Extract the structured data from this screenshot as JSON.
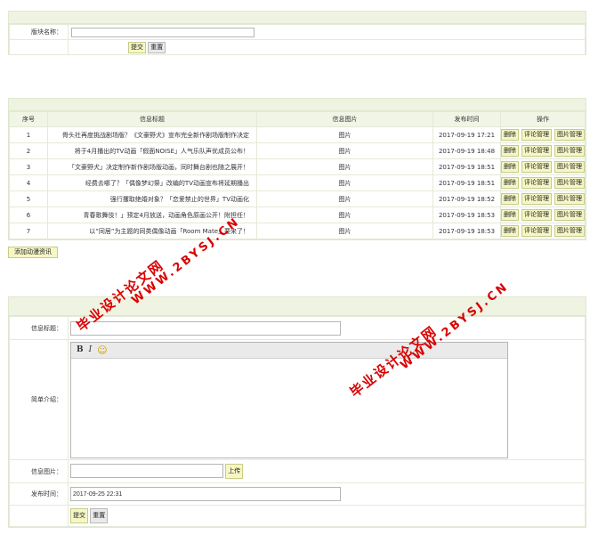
{
  "board_form": {
    "label": "版块名称：",
    "value": "",
    "submit": "提交",
    "reset": "重置"
  },
  "news_table": {
    "headers": [
      "序号",
      "信息标题",
      "信息图片",
      "发布时间",
      "操作"
    ],
    "rows": [
      {
        "no": "1",
        "title": "骨头社再度挑战剧场版？《文豪野犬》宣布完全新作剧场版制作决定",
        "image": "图片",
        "time": "2017-09-19 17:21"
      },
      {
        "no": "2",
        "title": "将于4月播出的TV动画「假面NOISE」人气乐队声优成员公布！",
        "image": "图片",
        "time": "2017-09-19 18:48"
      },
      {
        "no": "3",
        "title": "「文豪野犬」决定制作新作剧场版动画，同时舞台剧也随之展开！",
        "image": "图片",
        "time": "2017-09-19 18:51"
      },
      {
        "no": "4",
        "title": "经费去哪了？「偶像梦幻祭」改编的TV动画宣布将延期播出",
        "image": "图片",
        "time": "2017-09-19 18:51"
      },
      {
        "no": "5",
        "title": "强行攫取绝婚对象？「恋爱禁止的世界」TV动画化",
        "image": "图片",
        "time": "2017-09-19 18:52"
      },
      {
        "no": "6",
        "title": "青春歌舞伎！」预定4月放送，动画角色原画公开！附担任！",
        "image": "图片",
        "time": "2017-09-19 18:53"
      },
      {
        "no": "7",
        "title": "以“同居”为主题的同类偶像动画「Room Mate」要来了！",
        "image": "图片",
        "time": "2017-09-19 18:53"
      }
    ],
    "ops": {
      "delete": "删除",
      "comments": "评论管理",
      "images": "图片管理"
    },
    "add_button": "添加动漫资讯"
  },
  "news_form": {
    "title_label": "信息标题：",
    "title_value": "",
    "intro_label": "简单介绍：",
    "editor_bold": "B",
    "editor_italic": "I",
    "editor_smiley": "☺",
    "image_label": "信息图片：",
    "upload": "上传",
    "time_label": "发布时间：",
    "time_value": "2017-09-25 22:31",
    "submit": "提交",
    "reset": "重置"
  },
  "watermarks": {
    "cn": "毕业设计论文网",
    "url": "WWW.2BYSJ.CN",
    "color": "#d90000"
  }
}
